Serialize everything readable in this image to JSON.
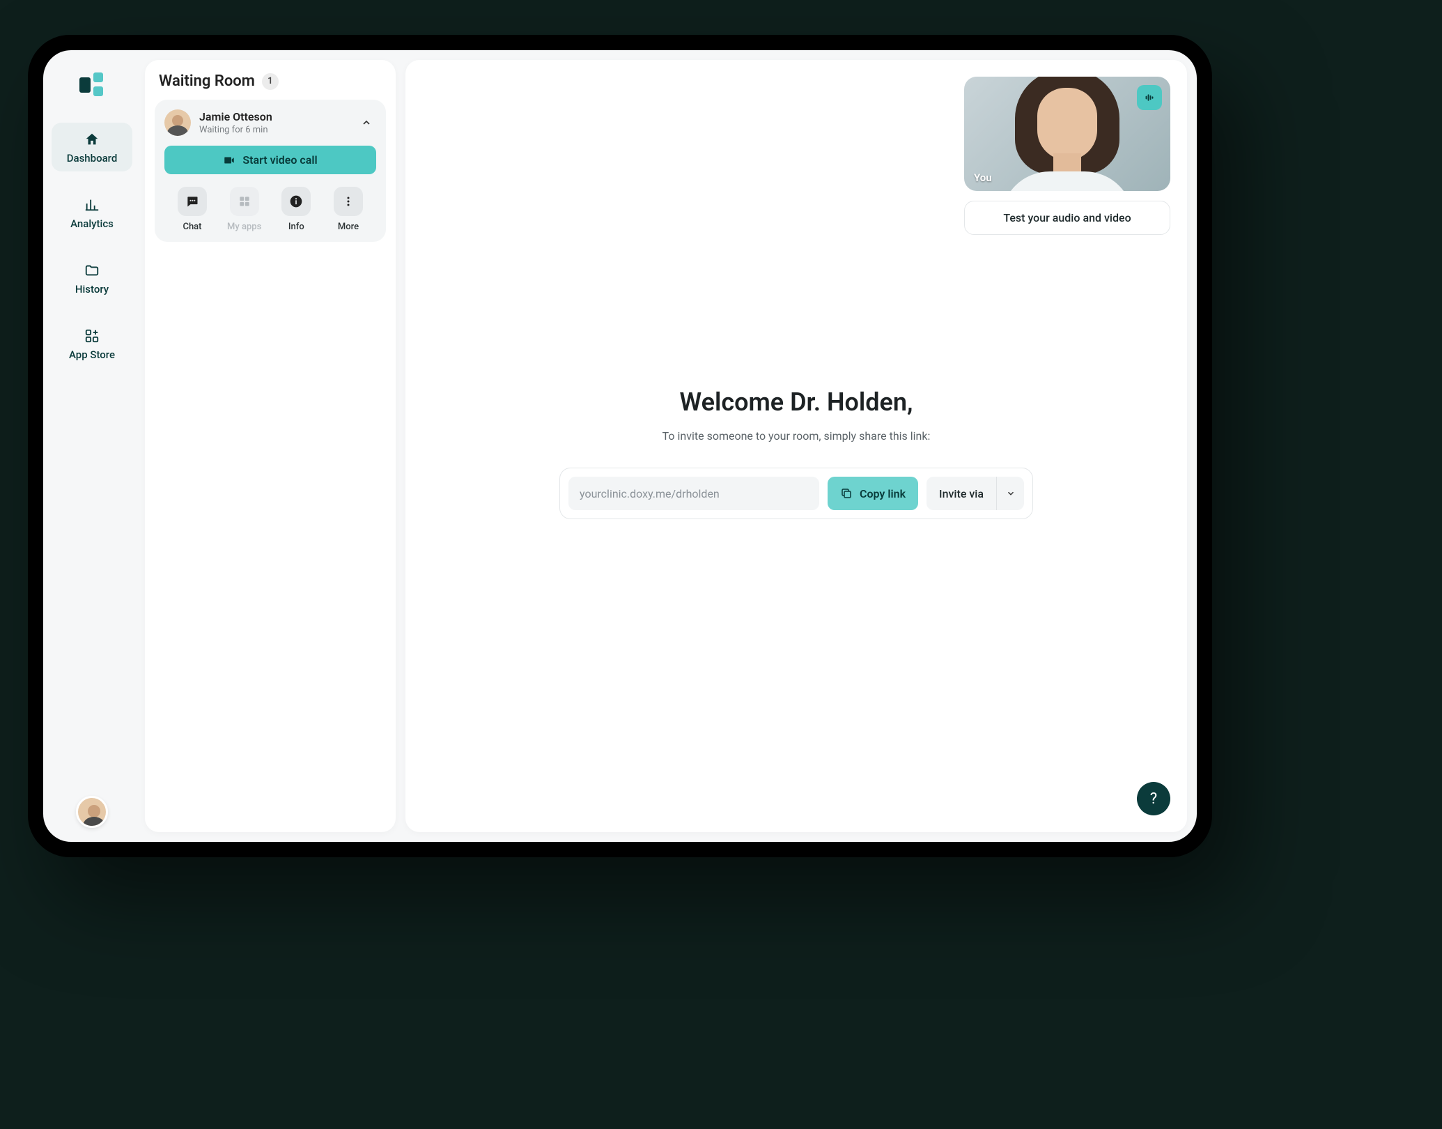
{
  "colors": {
    "accent": "#4dc8c3",
    "brand_dark": "#0b3b3b"
  },
  "sidebar": {
    "items": [
      {
        "label": "Dashboard",
        "active": true
      },
      {
        "label": "Analytics",
        "active": false
      },
      {
        "label": "History",
        "active": false
      },
      {
        "label": "App Store",
        "active": false
      }
    ]
  },
  "waiting_room": {
    "title": "Waiting Room",
    "count": "1",
    "patient": {
      "name": "Jamie Otteson",
      "status": "Waiting for 6 min"
    },
    "start_call_label": "Start video call",
    "actions": [
      {
        "label": "Chat",
        "enabled": true
      },
      {
        "label": "My apps",
        "enabled": false
      },
      {
        "label": "Info",
        "enabled": true
      },
      {
        "label": "More",
        "enabled": true
      }
    ]
  },
  "video": {
    "self_label": "You",
    "test_av_label": "Test your audio and video"
  },
  "welcome": {
    "title": "Welcome Dr. Holden,",
    "subtitle": "To invite someone to your room, simply share this link:",
    "room_link": "yourclinic.doxy.me/drholden",
    "copy_label": "Copy link",
    "invite_via_label": "Invite via"
  },
  "help_label": "?"
}
